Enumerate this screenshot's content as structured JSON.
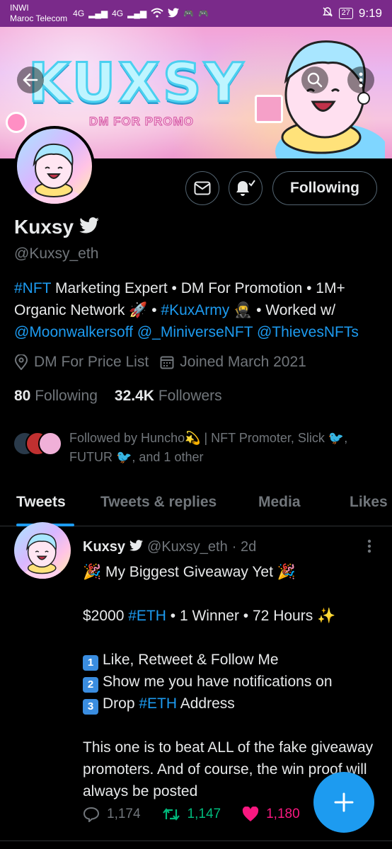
{
  "status_bar": {
    "carrier_line1": "INWI",
    "carrier_line2": "Maroc Telecom",
    "signal1": "4G",
    "signal2": "4G",
    "battery": "27",
    "time": "9:19"
  },
  "banner": {
    "title": "KUXSY",
    "subtitle": "DM FOR PROMO"
  },
  "profile": {
    "name": "Kuxsy",
    "handle": "@Kuxsy_eth",
    "following_button": "Following",
    "bio": {
      "tag1": "#NFT",
      "text1": " Marketing Expert • DM For Promotion • 1M+ Organic Network 🚀 • ",
      "tag2": "#KuxArmy",
      "text2": " 🥷 • Worked w/ ",
      "mention1": "@Moonwalkersoff",
      "mention2": "@_MiniverseNFT",
      "mention3": "@ThievesNFTs"
    },
    "location": "DM For Price List",
    "joined": "Joined March 2021",
    "following_count": "80",
    "following_label": "Following",
    "followers_count": "32.4K",
    "followers_label": "Followers",
    "followed_by": "Followed by Huncho💫 | NFT Promoter, Slick 🐦, FUTUR 🐦, and 1 other"
  },
  "tabs": [
    "Tweets",
    "Tweets & replies",
    "Media",
    "Likes"
  ],
  "tweet": {
    "name": "Kuxsy",
    "handle": "@Kuxsy_eth",
    "time": "· 2d",
    "line1": "🎉 My Biggest Giveaway Yet 🎉",
    "line2_pre": "$2000 ",
    "line2_tag": "#ETH",
    "line2_post": " • 1 Winner • 72 Hours ✨",
    "step1_num": "1",
    "step1": "Like, Retweet & Follow Me",
    "step2_num": "2",
    "step2": "Show me you have notifications on",
    "step3_num": "3",
    "step3_pre": "Drop ",
    "step3_tag": "#ETH",
    "step3_post": " Address",
    "paragraph": "This one is to beat ALL of the fake giveaway promoters. And of course, the win proof will always be posted",
    "replies": "1,174",
    "retweets": "1,147",
    "likes": "1,180"
  },
  "colors": {
    "accent": "#1d9bf0",
    "retweet": "#00ba7c",
    "like": "#f91880",
    "muted": "#71767b"
  }
}
